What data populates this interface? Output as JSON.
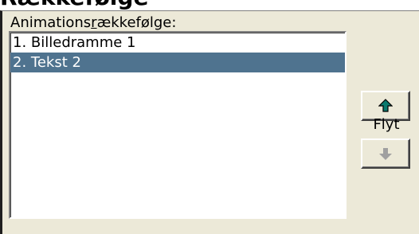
{
  "dialog": {
    "partial_heading": "Rækkefølge"
  },
  "animation_order": {
    "label_before": "Animations",
    "label_accel": "r",
    "label_after": "ækkefølge:",
    "items": [
      {
        "label": "1. Billedramme 1",
        "selected": false
      },
      {
        "label": "2. Tekst 2",
        "selected": true
      }
    ]
  },
  "move": {
    "label": "Flyt",
    "up_icon": "arrow-up-icon",
    "down_icon": "arrow-down-icon",
    "up_enabled": true,
    "down_enabled": false
  },
  "colors": {
    "selection": "#4f738f",
    "panel": "#ece9d8",
    "arrow_up": "#0a7a6e",
    "arrow_disabled": "#a0a0a0"
  }
}
